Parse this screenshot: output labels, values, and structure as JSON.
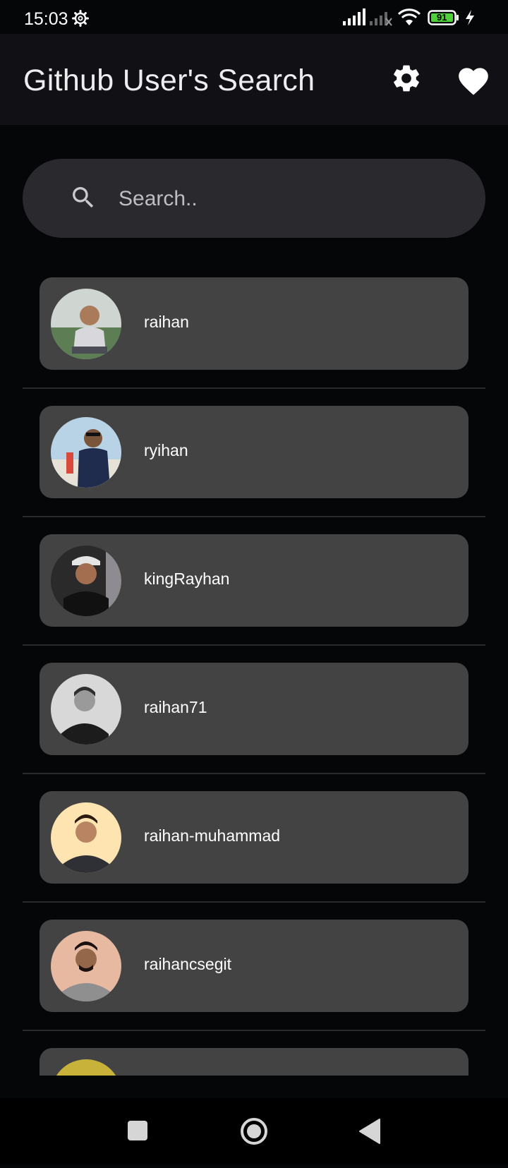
{
  "status_bar": {
    "time": "15:03",
    "battery": "91",
    "icons": [
      "gear-icon",
      "signal-icon",
      "signal-off-icon",
      "wifi-icon",
      "battery-icon",
      "charging-icon"
    ]
  },
  "app_bar": {
    "title": "Github User's Search",
    "actions": [
      "settings-icon",
      "heart-icon"
    ]
  },
  "search": {
    "placeholder": "Search..",
    "value": ""
  },
  "users": [
    {
      "login": "raihan",
      "avatar_bg": "#8fa69a"
    },
    {
      "login": "ryihan",
      "avatar_bg": "#b8cfe0"
    },
    {
      "login": "kingRayhan",
      "avatar_bg": "#2b2a2a"
    },
    {
      "login": "raihan71",
      "avatar_bg": "#d9d9d9"
    },
    {
      "login": "raihan-muhammad",
      "avatar_bg": "#fde4b0"
    },
    {
      "login": "raihancsegit",
      "avatar_bg": "#e6b9a0"
    },
    {
      "login": "",
      "avatar_bg": "#c9b23a"
    }
  ],
  "nav_bar": [
    "recents-icon",
    "home-icon",
    "back-icon"
  ],
  "colors": {
    "background": "#050608",
    "app_bar": "#111015",
    "search_box": "#2a2a2e",
    "card": "#434343",
    "divider": "#2a2b2f",
    "battery_fill": "#4cd137"
  }
}
